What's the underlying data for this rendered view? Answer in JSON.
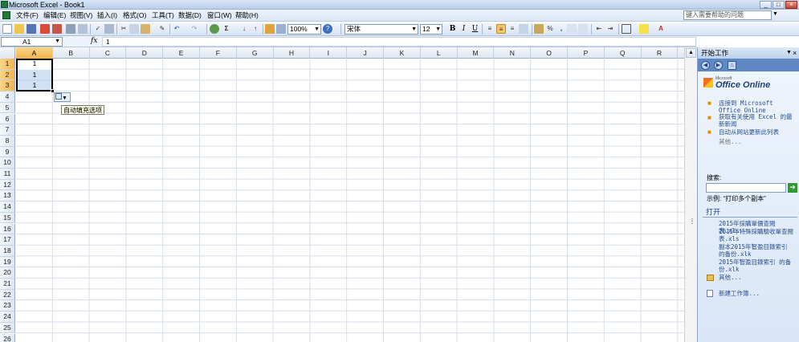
{
  "window": {
    "title": "Microsoft Excel - Book1",
    "minimize": "_",
    "maximize": "□",
    "close": "×"
  },
  "menu": {
    "items": [
      "文件(F)",
      "编辑(E)",
      "视图(V)",
      "插入(I)",
      "格式(O)",
      "工具(T)",
      "数据(D)",
      "窗口(W)",
      "帮助(H)"
    ],
    "help_search_placeholder": "键入需要帮助的问题"
  },
  "toolbar": {
    "zoom": "100%",
    "font_name": "宋体",
    "font_size": "12",
    "sum_symbol": "Σ",
    "bold": "B",
    "italic": "I",
    "underline": "U",
    "percent": "%",
    "comma": ","
  },
  "formula_bar": {
    "name_box": "A1",
    "fx": "fx",
    "value": "1"
  },
  "columns": [
    "A",
    "B",
    "C",
    "D",
    "E",
    "F",
    "G",
    "H",
    "I",
    "J",
    "K",
    "L",
    "M",
    "N",
    "O",
    "P",
    "Q",
    "R"
  ],
  "rows": [
    "1",
    "2",
    "3",
    "4",
    "5",
    "6",
    "7",
    "8",
    "9",
    "10",
    "11",
    "12",
    "13",
    "14",
    "15",
    "16",
    "17",
    "18",
    "19",
    "20",
    "21",
    "22",
    "23",
    "24",
    "25",
    "26"
  ],
  "cells": {
    "A1": "1",
    "A2": "1",
    "A3": "1"
  },
  "autofill": {
    "tooltip": "自动填充选项"
  },
  "task_pane": {
    "title": "开始工作",
    "office_online_small": "Microsoft",
    "office_online": "Office Online",
    "links": [
      "连接到 Microsoft Office Online",
      "获取有关使用 Excel 的最新新闻",
      "自动从网站更新此列表",
      "其他..."
    ],
    "search_label": "搜索:",
    "search_example": "示例: “打印多个副本”",
    "open_section": "打开",
    "recent_files": [
      "2015年採購單價查閱表.xls",
      "2015年特殊採購驗收單查閱表.xls",
      "副本2015年智盈目錄索引 的备份.xlk",
      "2015年智盈目錄索引 的备份.xlk",
      "其他..."
    ],
    "new_workbook": "新建工作簿..."
  }
}
